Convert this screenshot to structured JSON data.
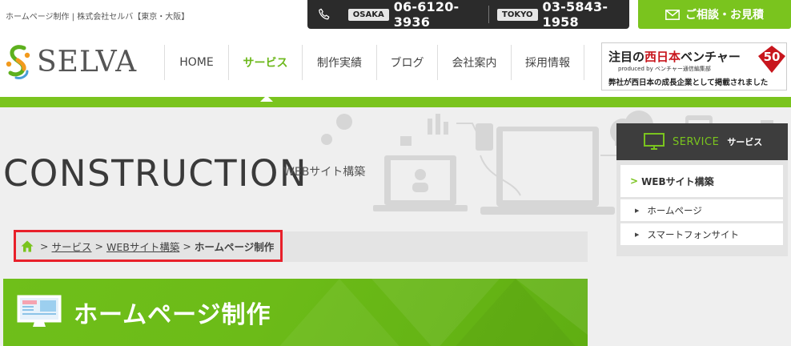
{
  "header": {
    "tagline": "ホームページ制作 | 株式会社セルバ【東京・大阪】",
    "phones": [
      {
        "city": "OSAKA",
        "number": "06-6120-3936"
      },
      {
        "city": "TOKYO",
        "number": "03-5843-1958"
      }
    ],
    "contact_label": "ご相談・お見積",
    "logo_text": "SELVA"
  },
  "nav": {
    "items": [
      {
        "label": "HOME",
        "active": false
      },
      {
        "label": "サービス",
        "active": true
      },
      {
        "label": "制作実績",
        "active": false
      },
      {
        "label": "ブログ",
        "active": false
      },
      {
        "label": "会社案内",
        "active": false
      },
      {
        "label": "採用情報",
        "active": false
      }
    ]
  },
  "banner": {
    "title_prefix": "注目の",
    "title_red": "西日本",
    "title_suffix": "ベンチャー",
    "badge": "50",
    "produced_by": "produced by ベンチャー通信編集部",
    "subtitle": "弊社が西日本の成長企業として掲載されました"
  },
  "hero": {
    "title": "CONSTRUCTION",
    "subtitle": "WEBサイト構築"
  },
  "breadcrumb": {
    "items": [
      "サービス",
      "WEBサイト構築"
    ],
    "current": "ホームページ制作",
    "separator": ">"
  },
  "page": {
    "title": "ホームページ制作"
  },
  "sidebar": {
    "header_en": "SERVICE",
    "header_jp": "サービス",
    "main_item": "WEBサイト構築",
    "sub_items": [
      "ホームページ",
      "スマートフォンサイト"
    ]
  },
  "colors": {
    "accent": "#7ac41e",
    "dark": "#2b2b2b",
    "highlight": "#e8202a"
  }
}
